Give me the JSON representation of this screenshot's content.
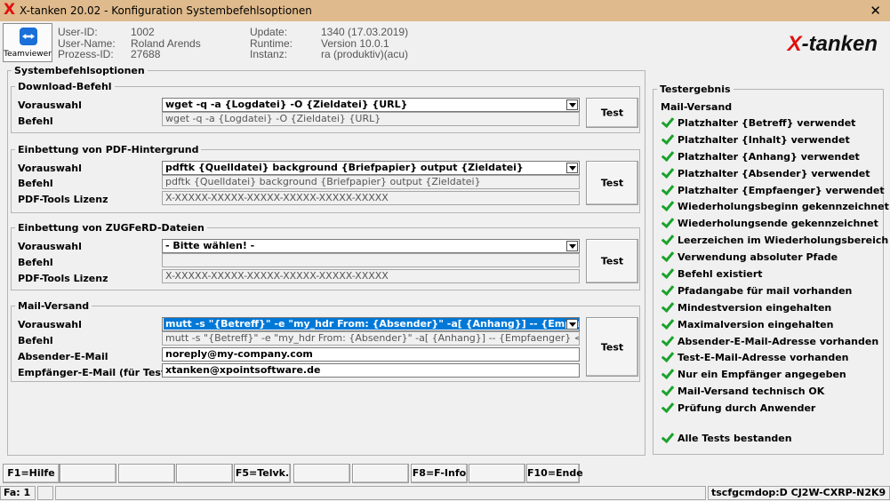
{
  "window": {
    "app_icon": "x-logo-icon",
    "title": "X-tanken 20.02  - Konfiguration Systembefehlsoptionen",
    "close_glyph": "✕"
  },
  "header": {
    "teamviewer_label": "Teamviewer",
    "info_labels_left": [
      "User-ID:",
      "User-Name:",
      "Prozess-ID:"
    ],
    "info_values_left": [
      "1002",
      "Roland Arends",
      "27688"
    ],
    "info_labels_right": [
      "Update:",
      "Runtime:",
      "Instanz:"
    ],
    "info_values_right": [
      "1340 (17.03.2019)",
      "Version 10.0.1",
      "ra (produktiv)(acu)"
    ],
    "brand_x": "X",
    "brand_rest": "-tanken"
  },
  "main": {
    "outer_legend": "Systembefehlsoptionen",
    "download": {
      "legend": "Download-Befehl",
      "vorauswahl_label": "Vorauswahl",
      "vorauswahl_value": "wget -q -a {Logdatei} -O {Zieldatei} {URL}",
      "befehl_label": "Befehl",
      "befehl_value": "wget -q -a {Logdatei} -O {Zieldatei} {URL}",
      "test_label": "Test"
    },
    "pdf": {
      "legend": "Einbettung von PDF-Hintergrund",
      "vorauswahl_label": "Vorauswahl",
      "vorauswahl_value": "pdftk {Quelldatei} background {Briefpapier} output {Zieldatei}",
      "befehl_label": "Befehl",
      "befehl_value": "pdftk {Quelldatei} background {Briefpapier} output {Zieldatei}",
      "lizenz_label": "PDF-Tools Lizenz",
      "lizenz_value": "X-XXXXX-XXXXX-XXXXX-XXXXX-XXXXX-XXXXX",
      "test_label": "Test"
    },
    "zugferd": {
      "legend": "Einbettung von ZUGFeRD-Dateien",
      "vorauswahl_label": "Vorauswahl",
      "vorauswahl_value": "- Bitte wählen! -",
      "befehl_label": "Befehl",
      "befehl_value": "",
      "lizenz_label": "PDF-Tools Lizenz",
      "lizenz_value": "X-XXXXX-XXXXX-XXXXX-XXXXX-XXXXX-XXXXX",
      "test_label": "Test"
    },
    "mail": {
      "legend": "Mail-Versand",
      "vorauswahl_label": "Vorauswahl",
      "vorauswahl_value": "mutt -s \"{Betreff}\" -e \"my_hdr From: {Absender}\" -a[ {Anhang}] -- {Empfaenger} <{Inhalt}",
      "befehl_label": "Befehl",
      "befehl_value": "mutt -s \"{Betreff}\" -e \"my_hdr From: {Absender}\" -a[ {Anhang}] -- {Empfaenger} <{Inhalt}",
      "absender_label": "Absender-E-Mail",
      "absender_value": "noreply@my-company.com",
      "empfaenger_label": "Empfänger-E-Mail (für Test)",
      "empfaenger_value": "xtanken@xpointsoftware.de",
      "test_label": "Test"
    }
  },
  "results": {
    "legend": "Testergebnis",
    "heading": "Mail-Versand",
    "check_icon": "checkmark-icon",
    "check_color": "#1aa32b",
    "items": [
      "Platzhalter {Betreff} verwendet",
      "Platzhalter {Inhalt} verwendet",
      "Platzhalter {Anhang} verwendet",
      "Platzhalter {Absender} verwendet",
      "Platzhalter {Empfaenger} verwendet",
      "Wiederholungsbeginn gekennzeichnet",
      "Wiederholungsende gekennzeichnet",
      "Leerzeichen im Wiederholungsbereich",
      "Verwendung absoluter Pfade",
      "Befehl existiert",
      "Pfadangabe für mail vorhanden",
      "Mindestversion eingehalten",
      "Maximalversion eingehalten",
      "Absender-E-Mail-Adresse vorhanden",
      "Test-E-Mail-Adresse vorhanden",
      "Nur ein Empfänger angegeben",
      "Mail-Versand technisch OK",
      "Prüfung durch Anwender"
    ],
    "final": "Alle Tests bestanden"
  },
  "fkeys": [
    "F1=Hilfe",
    "",
    "",
    "",
    "F5=Telvk.",
    "",
    "",
    "F8=F-Info",
    "",
    "F10=Ende"
  ],
  "status": {
    "left": "Fa: 1",
    "middle": "",
    "right": "tscfgcmdop:D CJ2W-CXRP-N2K9"
  },
  "colors": {
    "titlebar": "#dfba8c",
    "brand_red": "#e01010",
    "selection_blue": "#0078d7"
  }
}
